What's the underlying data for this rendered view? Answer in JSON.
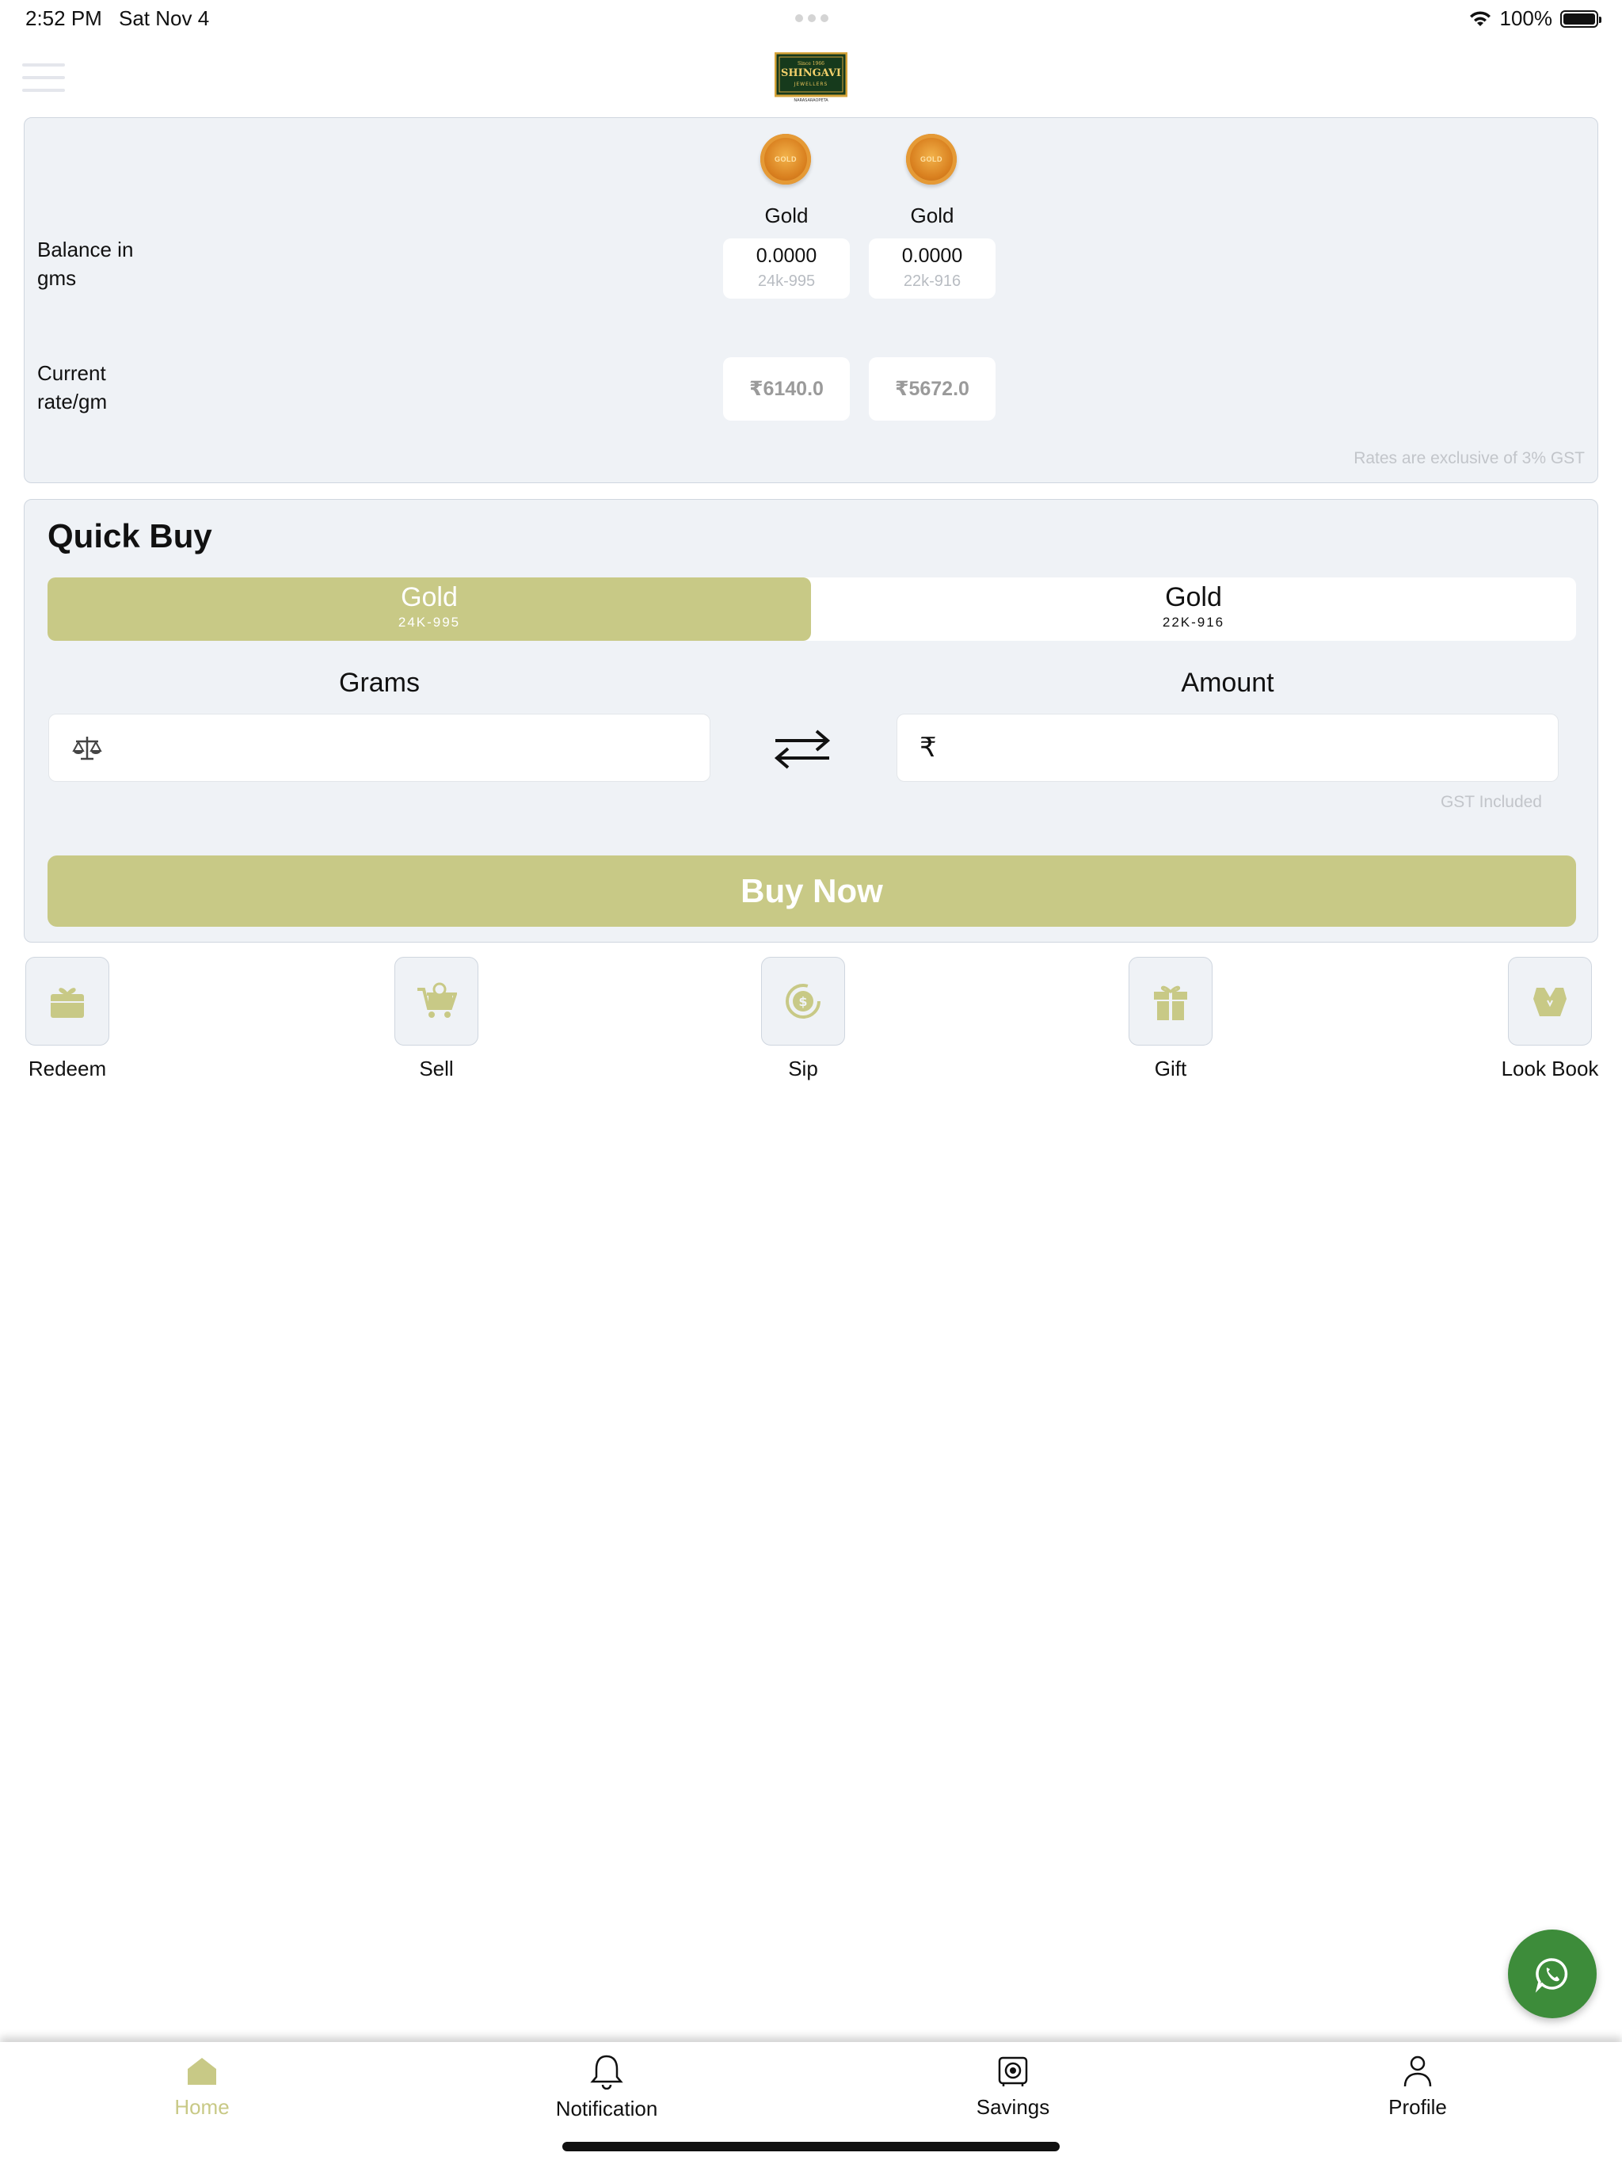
{
  "status_bar": {
    "time": "2:52 PM",
    "date": "Sat Nov 4",
    "battery": "100%"
  },
  "header": {
    "logo_text": "SHINGAVI"
  },
  "balance": {
    "row_balance_label": "Balance in gms",
    "row_rate_label": "Current rate/gm",
    "coin_text": "GOLD",
    "metals": [
      {
        "name": "Gold",
        "balance": "0.0000",
        "purity": "24k-995",
        "rate": "₹6140.0"
      },
      {
        "name": "Gold",
        "balance": "0.0000",
        "purity": "22k-916",
        "rate": "₹5672.0"
      }
    ],
    "note": "Rates are exclusive of 3% GST"
  },
  "quick_buy": {
    "title": "Quick Buy",
    "options": [
      {
        "label": "Gold",
        "sub": "24K-995",
        "active": true
      },
      {
        "label": "Gold",
        "sub": "22K-916",
        "active": false
      }
    ],
    "grams_label": "Grams",
    "amount_label": "Amount",
    "grams_value": "",
    "amount_value": "",
    "rupee_symbol": "₹",
    "gst_note": "GST Included",
    "buy_label": "Buy Now"
  },
  "actions": [
    {
      "label": "Redeem",
      "icon": "redeem-icon"
    },
    {
      "label": "Sell",
      "icon": "sell-cart-icon"
    },
    {
      "label": "Sip",
      "icon": "sip-coin-icon"
    },
    {
      "label": "Gift",
      "icon": "gift-icon"
    },
    {
      "label": "Look Book",
      "icon": "lookbook-icon"
    }
  ],
  "bottom_nav": [
    {
      "label": "Home",
      "icon": "home-icon",
      "active": true
    },
    {
      "label": "Notification",
      "icon": "bell-icon",
      "active": false
    },
    {
      "label": "Savings",
      "icon": "savings-icon",
      "active": false
    },
    {
      "label": "Profile",
      "icon": "profile-icon",
      "active": false
    }
  ],
  "colors": {
    "accent": "#c8c986",
    "card_bg": "#eff2f6",
    "whatsapp": "#3d8c3a"
  }
}
